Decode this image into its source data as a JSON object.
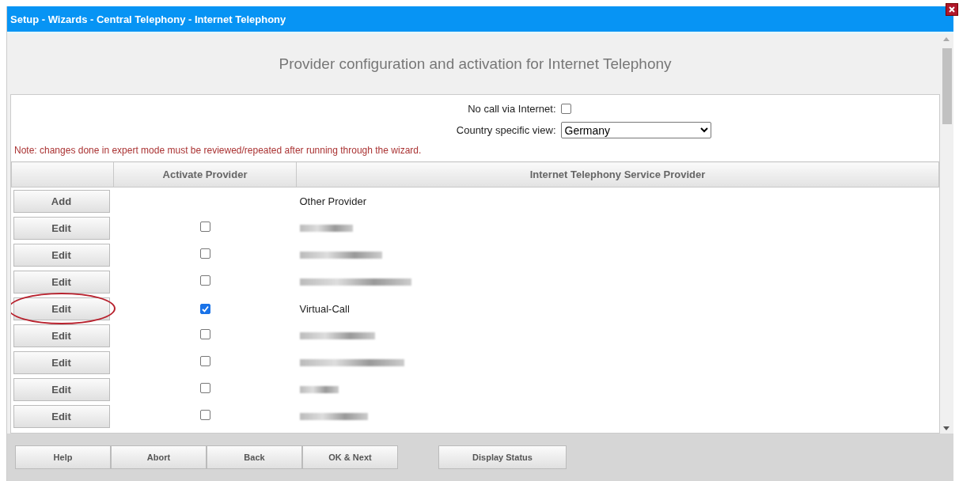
{
  "window": {
    "title": "Setup - Wizards - Central Telephony - Internet Telephony"
  },
  "heading": "Provider configuration and activation for Internet Telephony",
  "form": {
    "no_call_label": "No call via Internet:",
    "no_call_checked": false,
    "country_label": "Country specific view:",
    "country_value": "Germany"
  },
  "note": "Note: changes done in expert mode must be reviewed/repeated after running through the wizard.",
  "table": {
    "columns": [
      "Activate Provider",
      "Internet Telephony Service Provider"
    ],
    "rows": [
      {
        "button": "Add",
        "kind": "add",
        "name": "Other Provider"
      },
      {
        "button": "Edit",
        "kind": "provider",
        "checked": false,
        "redacted": true,
        "highlighted": false
      },
      {
        "button": "Edit",
        "kind": "provider",
        "checked": false,
        "redacted": true,
        "highlighted": false
      },
      {
        "button": "Edit",
        "kind": "provider",
        "checked": false,
        "redacted": true,
        "highlighted": false
      },
      {
        "button": "Edit",
        "kind": "provider",
        "checked": true,
        "name": "Virtual-Call",
        "highlighted": true
      },
      {
        "button": "Edit",
        "kind": "provider",
        "checked": false,
        "redacted": true,
        "highlighted": false
      },
      {
        "button": "Edit",
        "kind": "provider",
        "checked": false,
        "redacted": true,
        "highlighted": false
      },
      {
        "button": "Edit",
        "kind": "provider",
        "checked": false,
        "redacted": true,
        "highlighted": false
      },
      {
        "button": "Edit",
        "kind": "provider",
        "checked": false,
        "redacted": true,
        "highlighted": false
      }
    ]
  },
  "footer": {
    "buttons": [
      "Help",
      "Abort",
      "Back",
      "OK & Next"
    ],
    "status_button": "Display Status"
  }
}
